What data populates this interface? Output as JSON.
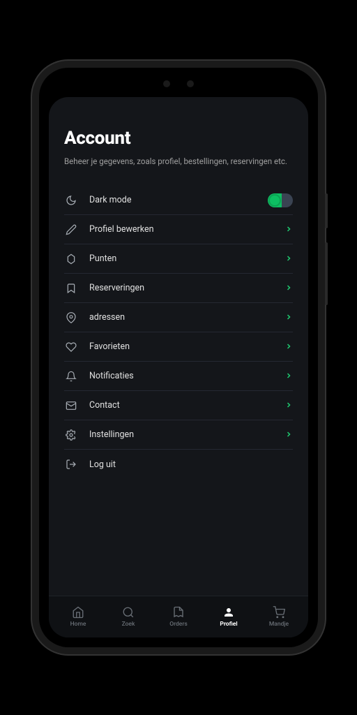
{
  "header": {
    "title": "Account",
    "subtitle": "Beheer je gegevens, zoals profiel, bestellingen, reservingen etc."
  },
  "items": [
    {
      "icon": "moon-icon",
      "label": "Dark mode",
      "type": "toggle",
      "on": true
    },
    {
      "icon": "pencil-icon",
      "label": "Profiel bewerken",
      "type": "link"
    },
    {
      "icon": "badge-icon",
      "label": "Punten",
      "type": "link"
    },
    {
      "icon": "bookmark-icon",
      "label": "Reserveringen",
      "type": "link"
    },
    {
      "icon": "pin-icon",
      "label": "adressen",
      "type": "link"
    },
    {
      "icon": "heart-icon",
      "label": "Favorieten",
      "type": "link"
    },
    {
      "icon": "bell-icon",
      "label": "Notificaties",
      "type": "link"
    },
    {
      "icon": "mail-icon",
      "label": "Contact",
      "type": "link"
    },
    {
      "icon": "gear-icon",
      "label": "Instellingen",
      "type": "link"
    },
    {
      "icon": "logout-icon",
      "label": "Log uit",
      "type": "link"
    }
  ],
  "nav": [
    {
      "icon": "home-icon",
      "label": "Home",
      "active": false
    },
    {
      "icon": "search-icon",
      "label": "Zoek",
      "active": false
    },
    {
      "icon": "receipt-icon",
      "label": "Orders",
      "active": false
    },
    {
      "icon": "user-icon",
      "label": "Profiel",
      "active": true
    },
    {
      "icon": "cart-icon",
      "label": "Mandje",
      "active": false
    }
  ],
  "colors": {
    "accent": "#0dbf62",
    "chevron": "#1ec86f",
    "bg": "#14161a"
  }
}
